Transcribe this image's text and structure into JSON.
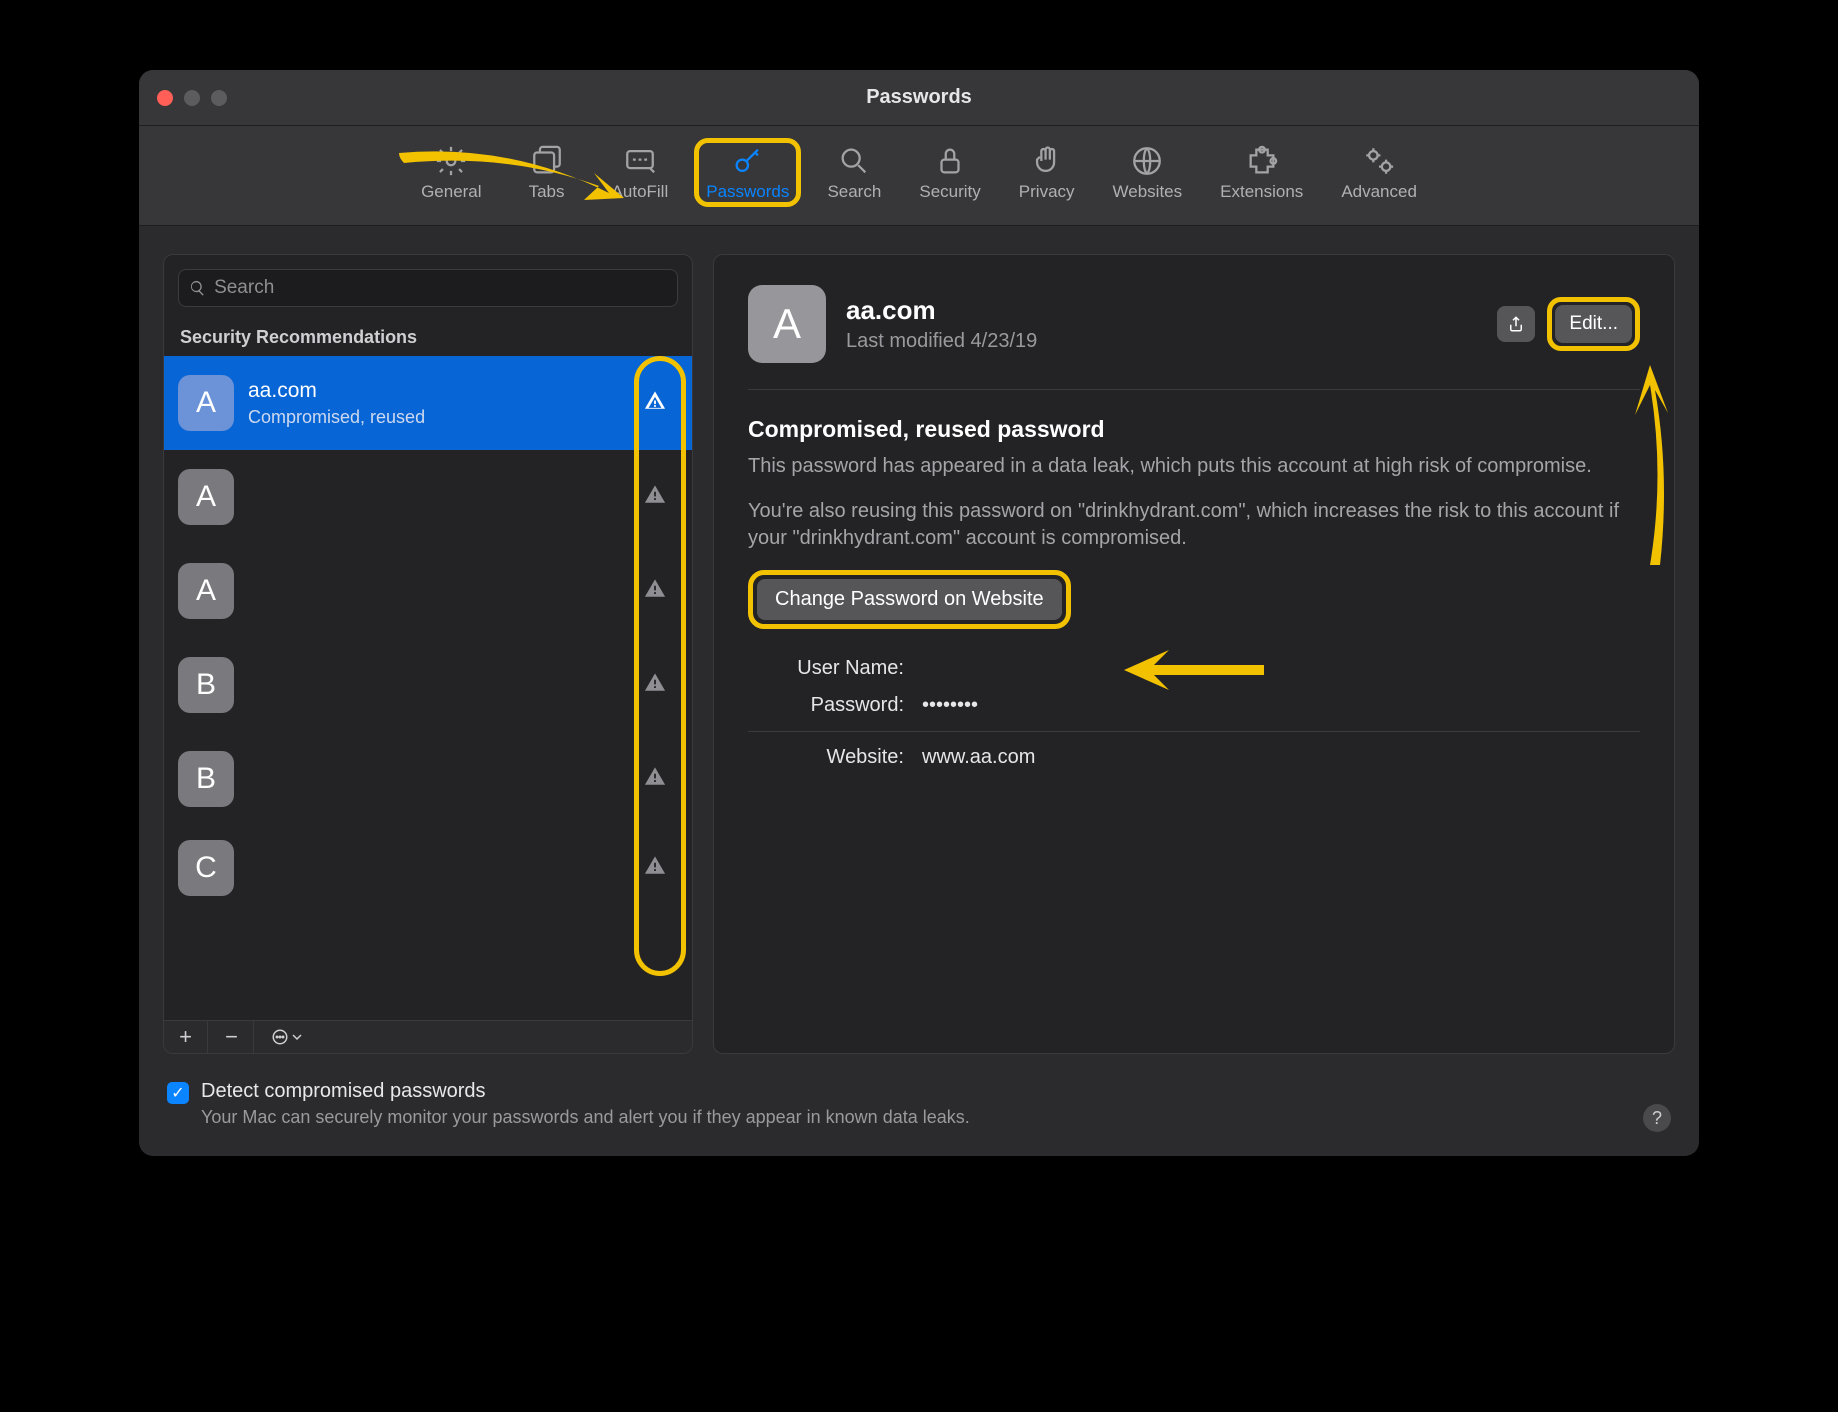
{
  "window": {
    "title": "Passwords"
  },
  "toolbar": {
    "items": [
      {
        "label": "General"
      },
      {
        "label": "Tabs"
      },
      {
        "label": "AutoFill"
      },
      {
        "label": "Passwords"
      },
      {
        "label": "Search"
      },
      {
        "label": "Security"
      },
      {
        "label": "Privacy"
      },
      {
        "label": "Websites"
      },
      {
        "label": "Extensions"
      },
      {
        "label": "Advanced"
      }
    ]
  },
  "sidebar": {
    "search_placeholder": "Search",
    "section_header": "Security Recommendations",
    "items": [
      {
        "letter": "A",
        "title": "aa.com",
        "sub": "Compromised, reused"
      },
      {
        "letter": "A"
      },
      {
        "letter": "A"
      },
      {
        "letter": "B"
      },
      {
        "letter": "B"
      },
      {
        "letter": "C"
      }
    ],
    "add": "+",
    "remove": "−",
    "more": "⊙ ⌄"
  },
  "detail": {
    "avatar_letter": "A",
    "title": "aa.com",
    "last_modified": "Last modified 4/23/19",
    "share_label": "",
    "edit_label": "Edit...",
    "warning_heading": "Compromised, reused password",
    "warning_body1": "This password has appeared in a data leak, which puts this account at high risk of compromise.",
    "warning_body2": "You're also reusing this password on \"drinkhydrant.com\", which increases the risk to this account if your \"drinkhydrant.com\" account is compromised.",
    "change_button": "Change Password on Website",
    "username_label": "User Name:",
    "username_value": "",
    "password_label": "Password:",
    "password_value": "••••••••",
    "website_label": "Website:",
    "website_value": "www.aa.com"
  },
  "footer": {
    "checkbox_checked": true,
    "title": "Detect compromised passwords",
    "sub": "Your Mac can securely monitor your passwords and alert you if they appear in known data leaks.",
    "help": "?"
  }
}
